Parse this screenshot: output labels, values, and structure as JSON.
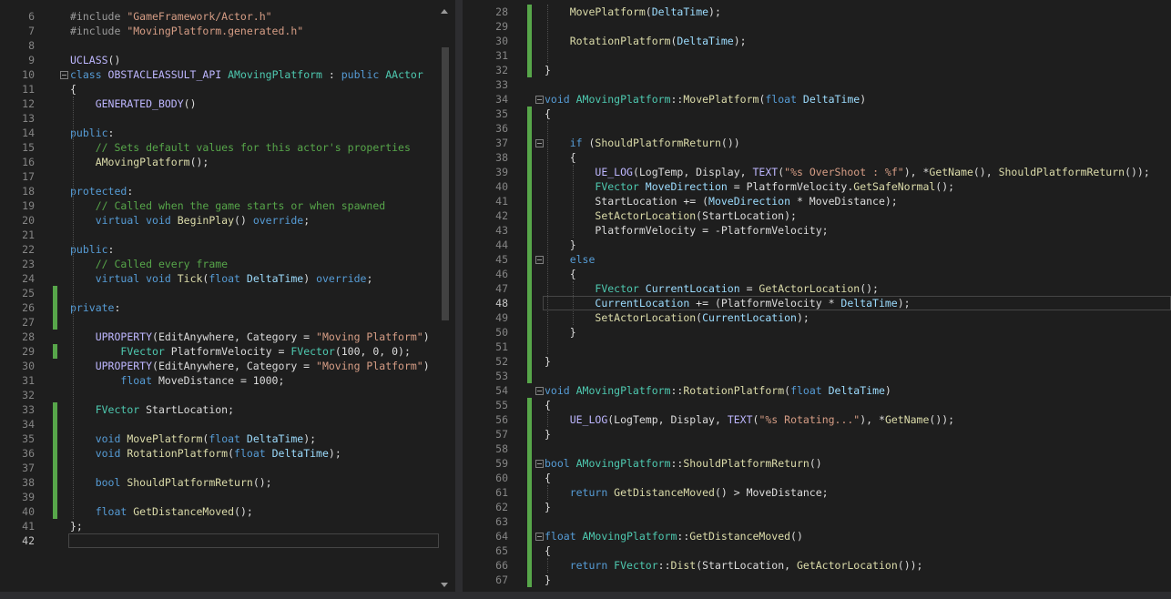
{
  "left_editor": {
    "lines": [
      {
        "n": "6",
        "t": [
          [
            "pp",
            "#include "
          ],
          [
            "st",
            "\"GameFramework/Actor.h\""
          ]
        ]
      },
      {
        "n": "7",
        "t": [
          [
            "pp",
            "#include "
          ],
          [
            "st",
            "\"MovingPlatform.generated.h\""
          ]
        ]
      },
      {
        "n": "8",
        "t": []
      },
      {
        "n": "9",
        "t": [
          [
            "mc",
            "UCLASS"
          ],
          [
            "",
            "()"
          ]
        ]
      },
      {
        "n": "10",
        "fold": true,
        "t": [
          [
            "kw",
            "class "
          ],
          [
            "mc",
            "OBSTACLEASSULT_API "
          ],
          [
            "ty",
            "AMovingPlatform"
          ],
          [
            "",
            " : "
          ],
          [
            "kw",
            "public "
          ],
          [
            "ty",
            "AActor"
          ]
        ]
      },
      {
        "n": "11",
        "t": [
          [
            "",
            "{"
          ]
        ]
      },
      {
        "n": "12",
        "t": [
          [
            "",
            "    "
          ],
          [
            "mc",
            "GENERATED_BODY"
          ],
          [
            "",
            "()"
          ]
        ]
      },
      {
        "n": "13",
        "t": []
      },
      {
        "n": "14",
        "t": [
          [
            "kw",
            "public"
          ],
          [
            "",
            ":"
          ]
        ]
      },
      {
        "n": "15",
        "t": [
          [
            "",
            "    "
          ],
          [
            "cm",
            "// Sets default values for this actor's properties"
          ]
        ]
      },
      {
        "n": "16",
        "t": [
          [
            "",
            "    "
          ],
          [
            "fn",
            "AMovingPlatform"
          ],
          [
            "",
            "();"
          ]
        ]
      },
      {
        "n": "17",
        "t": []
      },
      {
        "n": "18",
        "t": [
          [
            "kw",
            "protected"
          ],
          [
            "",
            ":"
          ]
        ]
      },
      {
        "n": "19",
        "t": [
          [
            "",
            "    "
          ],
          [
            "cm",
            "// Called when the game starts or when spawned"
          ]
        ]
      },
      {
        "n": "20",
        "t": [
          [
            "",
            "    "
          ],
          [
            "kw",
            "virtual void "
          ],
          [
            "fn",
            "BeginPlay"
          ],
          [
            "",
            "() "
          ],
          [
            "kw",
            "override"
          ],
          [
            "",
            ";"
          ]
        ]
      },
      {
        "n": "21",
        "t": []
      },
      {
        "n": "22",
        "t": [
          [
            "kw",
            "public"
          ],
          [
            "",
            ":"
          ]
        ]
      },
      {
        "n": "23",
        "t": [
          [
            "",
            "    "
          ],
          [
            "cm",
            "// Called every frame"
          ]
        ]
      },
      {
        "n": "24",
        "t": [
          [
            "",
            "    "
          ],
          [
            "kw",
            "virtual void "
          ],
          [
            "fn",
            "Tick"
          ],
          [
            "",
            "("
          ],
          [
            "kw",
            "float "
          ],
          [
            "pm",
            "DeltaTime"
          ],
          [
            "",
            ") "
          ],
          [
            "kw",
            "override"
          ],
          [
            "",
            ";"
          ]
        ]
      },
      {
        "n": "25",
        "chg": true,
        "t": []
      },
      {
        "n": "26",
        "chg": true,
        "t": [
          [
            "kw",
            "private"
          ],
          [
            "",
            ":"
          ]
        ]
      },
      {
        "n": "27",
        "chg": true,
        "t": []
      },
      {
        "n": "28",
        "t": [
          [
            "",
            "    "
          ],
          [
            "mc",
            "UPROPERTY"
          ],
          [
            "",
            "(EditAnywhere, Category = "
          ],
          [
            "st",
            "\"Moving Platform\""
          ],
          [
            "",
            ")"
          ]
        ]
      },
      {
        "n": "29",
        "chg": true,
        "t": [
          [
            "",
            "        "
          ],
          [
            "ty",
            "FVector "
          ],
          [
            "",
            "PlatformVelocity = "
          ],
          [
            "ty",
            "FVector"
          ],
          [
            "",
            "(100, 0, 0);"
          ]
        ]
      },
      {
        "n": "30",
        "t": [
          [
            "",
            "    "
          ],
          [
            "mc",
            "UPROPERTY"
          ],
          [
            "",
            "(EditAnywhere, Category = "
          ],
          [
            "st",
            "\"Moving Platform\""
          ],
          [
            "",
            ")"
          ]
        ]
      },
      {
        "n": "31",
        "t": [
          [
            "",
            "        "
          ],
          [
            "kw",
            "float "
          ],
          [
            "",
            "MoveDistance = 1000;"
          ]
        ]
      },
      {
        "n": "32",
        "t": []
      },
      {
        "n": "33",
        "chg": true,
        "t": [
          [
            "",
            "    "
          ],
          [
            "ty",
            "FVector "
          ],
          [
            "",
            "StartLocation;"
          ]
        ]
      },
      {
        "n": "34",
        "chg": true,
        "t": []
      },
      {
        "n": "35",
        "chg": true,
        "t": [
          [
            "",
            "    "
          ],
          [
            "kw",
            "void "
          ],
          [
            "fn",
            "MovePlatform"
          ],
          [
            "",
            "("
          ],
          [
            "kw",
            "float "
          ],
          [
            "pm",
            "DeltaTime"
          ],
          [
            "",
            ");"
          ]
        ]
      },
      {
        "n": "36",
        "chg": true,
        "t": [
          [
            "",
            "    "
          ],
          [
            "kw",
            "void "
          ],
          [
            "fn",
            "RotationPlatform"
          ],
          [
            "",
            "("
          ],
          [
            "kw",
            "float "
          ],
          [
            "pm",
            "DeltaTime"
          ],
          [
            "",
            ");"
          ]
        ]
      },
      {
        "n": "37",
        "chg": true,
        "t": []
      },
      {
        "n": "38",
        "chg": true,
        "t": [
          [
            "",
            "    "
          ],
          [
            "kw",
            "bool "
          ],
          [
            "fn",
            "ShouldPlatformReturn"
          ],
          [
            "",
            "();"
          ]
        ]
      },
      {
        "n": "39",
        "chg": true,
        "t": []
      },
      {
        "n": "40",
        "chg": true,
        "t": [
          [
            "",
            "    "
          ],
          [
            "kw",
            "float "
          ],
          [
            "fn",
            "GetDistanceMoved"
          ],
          [
            "",
            "();"
          ]
        ]
      },
      {
        "n": "41",
        "t": [
          [
            "",
            "};"
          ]
        ]
      },
      {
        "n": "42",
        "cur": true,
        "t": []
      }
    ]
  },
  "right_editor": {
    "lines": [
      {
        "n": "28",
        "chg": true,
        "t": [
          [
            "",
            "    "
          ],
          [
            "fn",
            "MovePlatform"
          ],
          [
            "",
            "("
          ],
          [
            "pm",
            "DeltaTime"
          ],
          [
            "",
            ");"
          ]
        ]
      },
      {
        "n": "29",
        "chg": true,
        "t": []
      },
      {
        "n": "30",
        "chg": true,
        "t": [
          [
            "",
            "    "
          ],
          [
            "fn",
            "RotationPlatform"
          ],
          [
            "",
            "("
          ],
          [
            "pm",
            "DeltaTime"
          ],
          [
            "",
            ");"
          ]
        ]
      },
      {
        "n": "31",
        "chg": true,
        "t": []
      },
      {
        "n": "32",
        "chg": true,
        "t": [
          [
            "",
            "}"
          ]
        ]
      },
      {
        "n": "33",
        "t": []
      },
      {
        "n": "34",
        "fold": true,
        "t": [
          [
            "kw",
            "void "
          ],
          [
            "ty",
            "AMovingPlatform"
          ],
          [
            "",
            "::"
          ],
          [
            "fn",
            "MovePlatform"
          ],
          [
            "",
            "("
          ],
          [
            "kw",
            "float "
          ],
          [
            "pm",
            "DeltaTime"
          ],
          [
            "",
            ")"
          ]
        ]
      },
      {
        "n": "35",
        "chg": true,
        "t": [
          [
            "",
            "{"
          ]
        ]
      },
      {
        "n": "36",
        "chg": true,
        "t": []
      },
      {
        "n": "37",
        "chg": true,
        "fold": true,
        "t": [
          [
            "",
            "    "
          ],
          [
            "kw",
            "if "
          ],
          [
            "",
            "("
          ],
          [
            "fn",
            "ShouldPlatformReturn"
          ],
          [
            "",
            "())"
          ]
        ]
      },
      {
        "n": "38",
        "chg": true,
        "t": [
          [
            "",
            "    {"
          ]
        ]
      },
      {
        "n": "39",
        "chg": true,
        "t": [
          [
            "",
            "        "
          ],
          [
            "mc",
            "UE_LOG"
          ],
          [
            "",
            "(LogTemp, Display, "
          ],
          [
            "mc",
            "TEXT"
          ],
          [
            "",
            "("
          ],
          [
            "st",
            "\"%s OverShoot : %f\""
          ],
          [
            "",
            "), *"
          ],
          [
            "fn",
            "GetName"
          ],
          [
            "",
            "(), "
          ],
          [
            "fn",
            "ShouldPlatformReturn"
          ],
          [
            "",
            "());"
          ]
        ]
      },
      {
        "n": "40",
        "chg": true,
        "t": [
          [
            "",
            "        "
          ],
          [
            "ty",
            "FVector "
          ],
          [
            "pm",
            "MoveDirection "
          ],
          [
            "",
            "= PlatformVelocity."
          ],
          [
            "fn",
            "GetSafeNormal"
          ],
          [
            "",
            "();"
          ]
        ]
      },
      {
        "n": "41",
        "chg": true,
        "t": [
          [
            "",
            "        StartLocation += ("
          ],
          [
            "pm",
            "MoveDirection "
          ],
          [
            "",
            "* MoveDistance);"
          ]
        ]
      },
      {
        "n": "42",
        "chg": true,
        "t": [
          [
            "",
            "        "
          ],
          [
            "fn",
            "SetActorLocation"
          ],
          [
            "",
            "(StartLocation);"
          ]
        ]
      },
      {
        "n": "43",
        "chg": true,
        "t": [
          [
            "",
            "        PlatformVelocity = -PlatformVelocity;"
          ]
        ]
      },
      {
        "n": "44",
        "chg": true,
        "t": [
          [
            "",
            "    }"
          ]
        ]
      },
      {
        "n": "45",
        "chg": true,
        "fold": true,
        "t": [
          [
            "",
            "    "
          ],
          [
            "kw",
            "else"
          ]
        ]
      },
      {
        "n": "46",
        "chg": true,
        "t": [
          [
            "",
            "    {"
          ]
        ]
      },
      {
        "n": "47",
        "chg": true,
        "t": [
          [
            "",
            "        "
          ],
          [
            "ty",
            "FVector "
          ],
          [
            "pm",
            "CurrentLocation "
          ],
          [
            "",
            "= "
          ],
          [
            "fn",
            "GetActorLocation"
          ],
          [
            "",
            "();"
          ]
        ]
      },
      {
        "n": "48",
        "chg": true,
        "cur": true,
        "t": [
          [
            "",
            "        "
          ],
          [
            "pm",
            "CurrentLocation "
          ],
          [
            "",
            "+= (PlatformVelocity * "
          ],
          [
            "pm",
            "DeltaTime"
          ],
          [
            "",
            ");"
          ]
        ]
      },
      {
        "n": "49",
        "chg": true,
        "t": [
          [
            "",
            "        "
          ],
          [
            "fn",
            "SetActorLocation"
          ],
          [
            "",
            "("
          ],
          [
            "pm",
            "CurrentLocation"
          ],
          [
            "",
            ");"
          ]
        ]
      },
      {
        "n": "50",
        "chg": true,
        "t": [
          [
            "",
            "    }"
          ]
        ]
      },
      {
        "n": "51",
        "chg": true,
        "t": []
      },
      {
        "n": "52",
        "chg": true,
        "t": [
          [
            "",
            "}"
          ]
        ]
      },
      {
        "n": "53",
        "chg": true,
        "t": []
      },
      {
        "n": "54",
        "fold": true,
        "t": [
          [
            "kw",
            "void "
          ],
          [
            "ty",
            "AMovingPlatform"
          ],
          [
            "",
            "::"
          ],
          [
            "fn",
            "RotationPlatform"
          ],
          [
            "",
            "("
          ],
          [
            "kw",
            "float "
          ],
          [
            "pm",
            "DeltaTime"
          ],
          [
            "",
            ")"
          ]
        ]
      },
      {
        "n": "55",
        "chg": true,
        "t": [
          [
            "",
            "{"
          ]
        ]
      },
      {
        "n": "56",
        "chg": true,
        "t": [
          [
            "",
            "    "
          ],
          [
            "mc",
            "UE_LOG"
          ],
          [
            "",
            "(LogTemp, Display, "
          ],
          [
            "mc",
            "TEXT"
          ],
          [
            "",
            "("
          ],
          [
            "st",
            "\"%s Rotating...\""
          ],
          [
            "",
            "), *"
          ],
          [
            "fn",
            "GetName"
          ],
          [
            "",
            "());"
          ]
        ]
      },
      {
        "n": "57",
        "chg": true,
        "t": [
          [
            "",
            "}"
          ]
        ]
      },
      {
        "n": "58",
        "chg": true,
        "t": []
      },
      {
        "n": "59",
        "chg": true,
        "fold": true,
        "t": [
          [
            "kw",
            "bool "
          ],
          [
            "ty",
            "AMovingPlatform"
          ],
          [
            "",
            "::"
          ],
          [
            "fn",
            "ShouldPlatformReturn"
          ],
          [
            "",
            "()"
          ]
        ]
      },
      {
        "n": "60",
        "chg": true,
        "t": [
          [
            "",
            "{"
          ]
        ]
      },
      {
        "n": "61",
        "chg": true,
        "t": [
          [
            "",
            "    "
          ],
          [
            "kw",
            "return "
          ],
          [
            "fn",
            "GetDistanceMoved"
          ],
          [
            "",
            "() > MoveDistance;"
          ]
        ]
      },
      {
        "n": "62",
        "chg": true,
        "t": [
          [
            "",
            "}"
          ]
        ]
      },
      {
        "n": "63",
        "chg": true,
        "t": []
      },
      {
        "n": "64",
        "chg": true,
        "fold": true,
        "t": [
          [
            "kw",
            "float "
          ],
          [
            "ty",
            "AMovingPlatform"
          ],
          [
            "",
            "::"
          ],
          [
            "fn",
            "GetDistanceMoved"
          ],
          [
            "",
            "()"
          ]
        ]
      },
      {
        "n": "65",
        "chg": true,
        "t": [
          [
            "",
            "{"
          ]
        ]
      },
      {
        "n": "66",
        "chg": true,
        "t": [
          [
            "",
            "    "
          ],
          [
            "kw",
            "return "
          ],
          [
            "ty",
            "FVector"
          ],
          [
            "",
            "::"
          ],
          [
            "fn",
            "Dist"
          ],
          [
            "",
            "(StartLocation, "
          ],
          [
            "fn",
            "GetActorLocation"
          ],
          [
            "",
            "());"
          ]
        ]
      },
      {
        "n": "67",
        "chg": true,
        "t": [
          [
            "",
            "}"
          ]
        ]
      }
    ]
  }
}
